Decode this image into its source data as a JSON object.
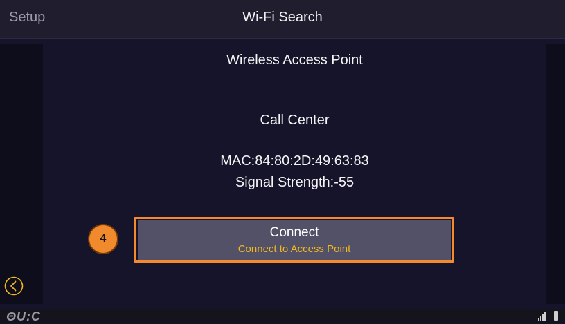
{
  "header": {
    "back_label": "Setup",
    "title": "Wi-Fi Search"
  },
  "content": {
    "heading": "Wireless Access Point",
    "ssid": "Call Center",
    "mac": "MAC:84:80:2D:49:63:83",
    "signal": "Signal Strength:-55"
  },
  "connect": {
    "label": "Connect",
    "sublabel": "Connect to Access Point"
  },
  "callout": {
    "number": "4"
  },
  "footer": {
    "logo": "ΘU:C",
    "signal_icon": "cell-signal-icon",
    "battery_icon": "battery-icon"
  },
  "colors": {
    "accent": "#f5892d",
    "sublabel": "#f2b820",
    "back_button": "#f2b820"
  }
}
